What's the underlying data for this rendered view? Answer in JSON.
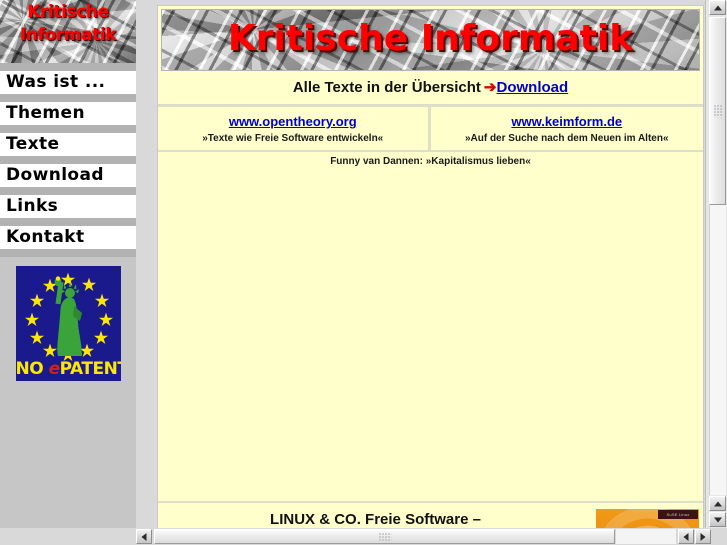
{
  "site": {
    "banner_line1": "Kritische",
    "banner_line2": "Informatik",
    "main_banner_title": "Kritische Informatik"
  },
  "sidebar": {
    "items": [
      {
        "label": "Was ist ..."
      },
      {
        "label": "Themen"
      },
      {
        "label": "Texte"
      },
      {
        "label": "Download"
      },
      {
        "label": "Links"
      },
      {
        "label": "Kontakt"
      }
    ],
    "badge": {
      "text_no": "NO ",
      "text_e": "e",
      "text_patents": "PATENTS",
      "bg_color": "#1a1a8c",
      "star_color": "#ffe800",
      "figure_color": "#3aa33a"
    }
  },
  "content": {
    "overview_text": "Alle Texte in der Übersicht",
    "arrow_glyph": "➔",
    "download_label": "Download",
    "links": [
      {
        "url_label": "www.opentheory.org",
        "subtitle": "»Texte wie Freie Software entwickeln«"
      },
      {
        "url_label": "www.keimform.de",
        "subtitle": "»Auf der Suche nach dem Neuen im Alten«"
      }
    ],
    "quote": "Funny van Dannen: »Kapitalismus lieben«",
    "footer_heading": "LINUX & CO. Freie Software –",
    "ad_tag_label": "SuSE Linux"
  },
  "colors": {
    "page_bg": "#ffffcc",
    "accent_red": "#ff0000",
    "link_blue": "#0000cc",
    "sidebar_sep": "#b2b2b2",
    "chrome_gray": "#d9d9d9"
  }
}
